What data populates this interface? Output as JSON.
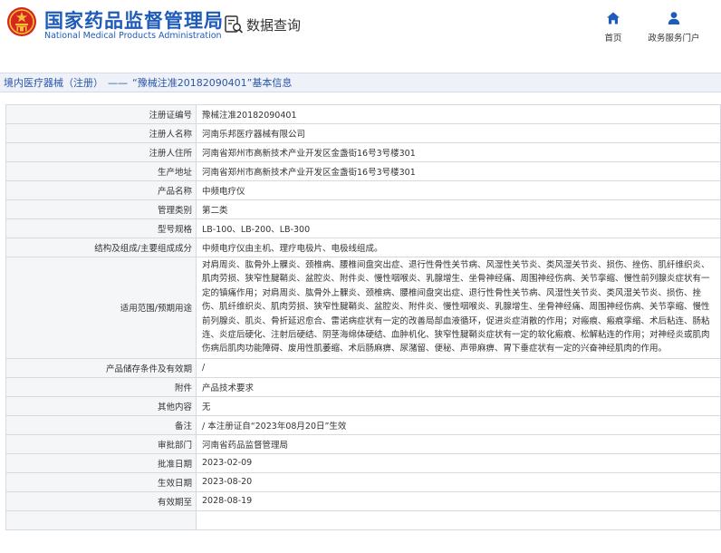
{
  "header": {
    "logo_cn": "国家药品监督管理局",
    "logo_en": "National Medical Products Administration",
    "search_label": "数据查询",
    "nav": {
      "home": "首页",
      "portal": "政务服务门户"
    }
  },
  "breadcrumb": {
    "category": "境内医疗器械（注册）",
    "separator": "——",
    "title": "“豫械注准20182090401”基本信息"
  },
  "details": {
    "rows": [
      {
        "label": "注册证编号",
        "value": "豫械注准20182090401"
      },
      {
        "label": "注册人名称",
        "value": "河南乐邦医疗器械有限公司"
      },
      {
        "label": "注册人住所",
        "value": "河南省郑州市高新技术产业开发区金盏街16号3号楼301"
      },
      {
        "label": "生产地址",
        "value": "河南省郑州市高新技术产业开发区金盏街16号3号楼301"
      },
      {
        "label": "产品名称",
        "value": "中频电疗仪"
      },
      {
        "label": "管理类别",
        "value": "第二类"
      },
      {
        "label": "型号规格",
        "value": "LB-100、LB-200、LB-300"
      },
      {
        "label": "结构及组成/主要组成成分",
        "value": "中频电疗仪由主机、理疗电极片、电极线组成。"
      },
      {
        "label": "适用范围/预期用途",
        "value": "对肩周炎、肱骨外上髁炎、颈椎病、腰椎间盘突出症、退行性骨性关节病、风湿性关节炎、类风湿关节炎、损伤、挫伤、肌纤维织炎、肌肉劳损、狭窄性腱鞘炎、盆腔炎、附件炎、慢性咽喉炎、乳腺增生、坐骨神经痛、周围神经伤病、关节挛缩、慢性前列腺炎症状有一定的镇痛作用；对肩周炎、肱骨外上髁炎、颈椎病、腰椎间盘突出症、退行性骨性关节病、风湿性关节炎、类风湿关节炎、损伤、挫伤、肌纤维织炎、肌肉劳损、狭窄性腱鞘炎、盆腔炎、附件炎、慢性咽喉炎、乳腺增生、坐骨神经痛、周围神经伤病、关节挛缩、慢性前列腺炎、肌炎、骨折延迟愈合、雷诺病症状有一定的改善局部血液循环，促进炎症消散的作用；对瘢痕、瘢痕挛缩、术后粘连、肠粘连、炎症后硬化、注射后硬结、阴茎海绵体硬结、血肿机化、狭窄性腱鞘炎症状有一定的软化瘢痕、松解粘连的作用；对神经炎或肌肉伤病后肌肉功能障碍、废用性肌萎缩、术后肠麻痹、尿潴留、便秘、声带麻痹、胃下垂症状有一定的兴奋神经肌肉的作用。"
      },
      {
        "label": "产品储存条件及有效期",
        "value": "/"
      },
      {
        "label": "附件",
        "value": "产品技术要求"
      },
      {
        "label": "其他内容",
        "value": "无"
      },
      {
        "label": "备注",
        "value": "/ 本注册证自“2023年08月20日”生效"
      },
      {
        "label": "审批部门",
        "value": "河南省药品监督管理局"
      },
      {
        "label": "批准日期",
        "value": "2023-02-09"
      },
      {
        "label": "生效日期",
        "value": "2023-08-20"
      },
      {
        "label": "有效期至",
        "value": "2028-08-19"
      },
      {
        "label": "",
        "value": ""
      }
    ]
  },
  "colors": {
    "brand_blue": "#1f5bb8",
    "emblem_red": "#d7261e",
    "emblem_gold": "#f2c13a",
    "label_bg": "#f5f6f8",
    "border": "#d6d9e0"
  },
  "icons": [
    "national-emblem-icon",
    "search-doc-icon",
    "home-icon",
    "user-icon"
  ]
}
